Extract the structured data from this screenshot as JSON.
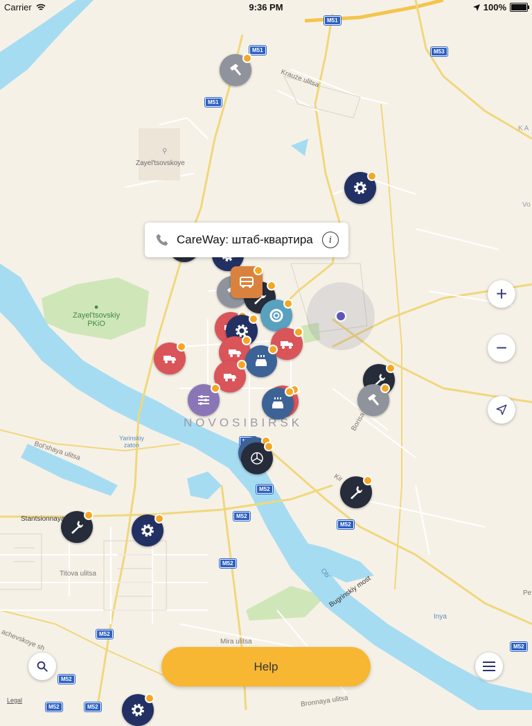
{
  "status_bar": {
    "carrier": "Carrier",
    "time": "9:36 PM",
    "battery": "100%"
  },
  "map": {
    "city": "NOVOSIBIRSK",
    "places": {
      "zayeltsovskoye": "Zayel'tsovskoye",
      "park_line1": "Zayel'tsovskiy",
      "park_line2": "PKiO",
      "krauze": "Krauze ulitsa",
      "bolshaya": "Bol'shaya ulitsa",
      "stantsionnaya": "Stantsionnaya",
      "titova": "Titova ulitsa",
      "mira": "Mira ulitsa",
      "bronnaya": "Bronnaya ulitsa",
      "bugrinskiy": "Bugrinskiy most",
      "bogatkova": "Borisa Bogatkova ulitsa",
      "yarinskiy1": "Yarinskiy",
      "yarinskiy2": "zaton",
      "ob": "Ob'",
      "inya": "Inya",
      "ka": "KA",
      "vo": "Vo",
      "kir": "Kir",
      "achevskoye": "achevskoye sh",
      "sl": "S",
      "pe": "Pe"
    },
    "shields": {
      "m51a": "M51",
      "m51b": "M51",
      "m51c": "M51",
      "m53": "M53",
      "m52a": "M52",
      "m52b": "M52",
      "m52c": "M52",
      "m52d": "M52",
      "m52e": "M52",
      "m52f": "M52",
      "m52g": "M52",
      "m52h": "M52",
      "m52i": "M52",
      "m52j": "M52"
    }
  },
  "pins": [
    {
      "name": "hammer-pin",
      "icon": "hammer",
      "color": "#8e939c"
    },
    {
      "name": "settings-pin",
      "icon": "gear",
      "color": "#233063"
    },
    {
      "name": "tow-truck-pin",
      "icon": "truck",
      "color": "#d9555a"
    },
    {
      "name": "wrench-pin",
      "icon": "wrench",
      "color": "#262c3a"
    },
    {
      "name": "lifebuoy-pin",
      "icon": "lifebuoy",
      "color": "#5aa0bf"
    },
    {
      "name": "car-wash-pin",
      "icon": "carwash",
      "color": "#3d6396"
    },
    {
      "name": "tuning-pin",
      "icon": "tuning",
      "color": "#8a76b7"
    },
    {
      "name": "mercedes-pin",
      "icon": "mercedes",
      "color": "#262c3a"
    }
  ],
  "callout": {
    "title": "CareWay: штаб-квартира"
  },
  "controls": {
    "zoom_in": "+",
    "zoom_out": "−"
  },
  "help_button": {
    "label": "Help"
  },
  "legal": "Legal"
}
